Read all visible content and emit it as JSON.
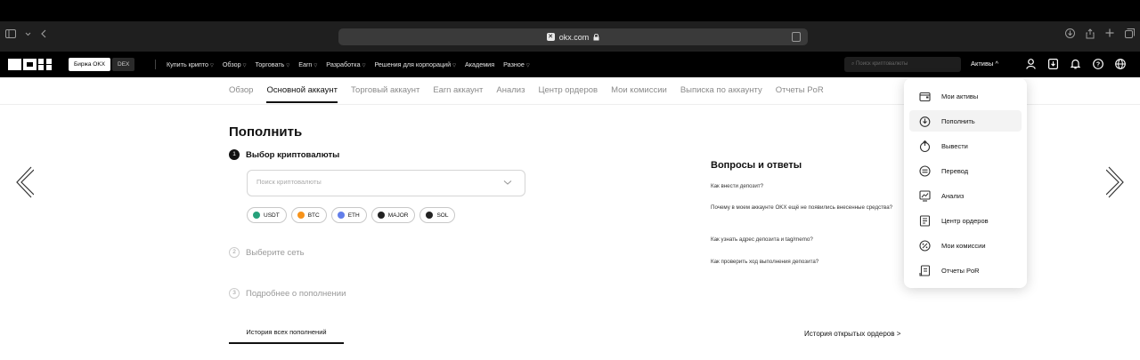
{
  "browser": {
    "url": "okx.com"
  },
  "nav": {
    "exchange_toggle": {
      "active": "Биржа OKX",
      "inactive": "DEX"
    },
    "menu": [
      {
        "label": "Купить крипто",
        "caret": true
      },
      {
        "label": "Обзор",
        "caret": true
      },
      {
        "label": "Торговать",
        "caret": true
      },
      {
        "label": "Earn",
        "caret": true
      },
      {
        "label": "Разработка",
        "caret": true
      },
      {
        "label": "Решения для корпораций",
        "caret": true
      },
      {
        "label": "Академия",
        "caret": false
      },
      {
        "label": "Разное",
        "caret": true
      }
    ],
    "search_placeholder": "Поиск криптовалюты",
    "assets_label": "Активы ^"
  },
  "subnav": {
    "tabs": [
      {
        "label": "Обзор",
        "active": false
      },
      {
        "label": "Основной аккаунт",
        "active": true
      },
      {
        "label": "Торговый аккаунт",
        "active": false
      },
      {
        "label": "Earn аккаунт",
        "active": false
      },
      {
        "label": "Анализ",
        "active": false
      },
      {
        "label": "Центр ордеров",
        "active": false
      },
      {
        "label": "Мои комиссии",
        "active": false
      },
      {
        "label": "Выписка по аккаунту",
        "active": false
      },
      {
        "label": "Отчеты PoR",
        "active": false
      }
    ]
  },
  "deposit": {
    "title": "Пополнить",
    "steps": [
      {
        "num": "1",
        "label": "Выбор криптовалюты",
        "active": true
      },
      {
        "num": "2",
        "label": "Выберите сеть",
        "active": false
      },
      {
        "num": "3",
        "label": "Подробнее о пополнении",
        "active": false
      }
    ],
    "search_placeholder": "Поиск криптовалюты",
    "coins": [
      {
        "label": "USDT",
        "color": "#26a17b"
      },
      {
        "label": "BTC",
        "color": "#f7931a"
      },
      {
        "label": "ETH",
        "color": "#627eea"
      },
      {
        "label": "MAJOR",
        "color": "#222222"
      },
      {
        "label": "SOL",
        "color": "#222222"
      }
    ],
    "history_tab": "История всех пополнений",
    "open_orders_link": "История открытых ордеров >"
  },
  "faq": {
    "title": "Вопросы и ответы",
    "questions": [
      "Как внести депозит?",
      "Почему в моем аккаунте OKX ещё не появились внесенные средства?",
      "Как узнать адрес депозита и tag/memo?",
      "Как проверить ход выполнения депозита?"
    ]
  },
  "dropdown": {
    "items": [
      {
        "label": "Мои активы",
        "icon": "wallet-icon"
      },
      {
        "label": "Пополнить",
        "icon": "deposit-icon"
      },
      {
        "label": "Вывести",
        "icon": "withdraw-icon"
      },
      {
        "label": "Перевод",
        "icon": "transfer-icon"
      },
      {
        "label": "Анализ",
        "icon": "analysis-icon"
      },
      {
        "label": "Центр ордеров",
        "icon": "orders-icon"
      },
      {
        "label": "Мои комиссии",
        "icon": "fees-icon"
      },
      {
        "label": "Отчеты PoR",
        "icon": "report-icon"
      }
    ],
    "hovered_index": 1
  }
}
